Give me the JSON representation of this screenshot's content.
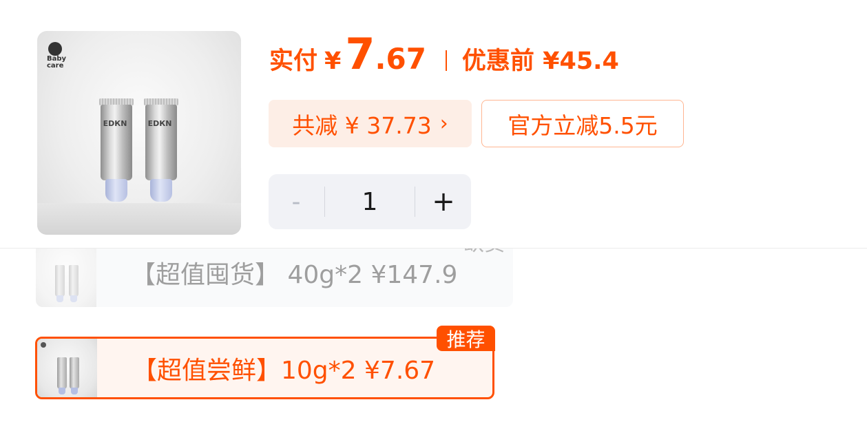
{
  "product": {
    "brand_logo_text": "Baby care",
    "tube_label": "ЕDКN"
  },
  "price": {
    "label_paid": "实付",
    "currency": "¥",
    "integer": "7",
    "decimal": ".67",
    "label_before": "优惠前 ¥45.4"
  },
  "discount": {
    "total_label": "共减 ¥ 37.73",
    "arrow": "›",
    "coupon_label": "官方立减5.5元"
  },
  "stepper": {
    "minus": "-",
    "quantity": "1",
    "plus": "+"
  },
  "skus": [
    {
      "label": "【超值囤货】 40g*2  ¥147.9",
      "status": "缺货"
    },
    {
      "label": "【超值尝鲜】10g*2  ¥7.67",
      "badge": "推荐"
    }
  ],
  "colors": {
    "accent": "#ff5000",
    "discount_bg": "#fdeee6",
    "stepper_bg": "#f1f2f6",
    "selected_bg": "#fff5f0"
  }
}
